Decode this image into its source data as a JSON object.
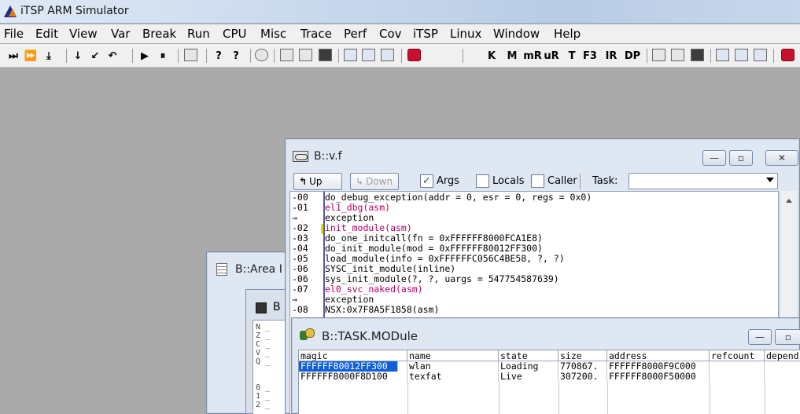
{
  "app": {
    "title": "iTSP ARM Simulator"
  },
  "menu": [
    "File",
    "Edit",
    "View",
    "Var",
    "Break",
    "Run",
    "CPU",
    "Misc",
    "Trace",
    "Perf",
    "Cov",
    "iTSP",
    "Linux",
    "Window",
    "Help"
  ],
  "toolbar": {
    "glyphs": [
      "⏭",
      "⏩",
      "⤓",
      "↓",
      "↙",
      "↶",
      "▶",
      "⏸"
    ],
    "letters": [
      "K",
      "M",
      "mR",
      "uR",
      "T",
      "F3",
      "IR",
      "DP"
    ],
    "help": [
      "?",
      "?"
    ]
  },
  "area_window": {
    "title": "B::Area I",
    "sub_title": "B",
    "regs": [
      "N _",
      "Z _",
      "C _",
      "V _",
      "Q _",
      "",
      "0 _",
      "1 _",
      "2 _"
    ]
  },
  "vf_window": {
    "title": "B::v.f",
    "up_label": "Up",
    "down_label": "Down",
    "args_label": "Args",
    "locals_label": "Locals",
    "caller_label": "Caller",
    "task_label": "Task:",
    "args_checked": "✓",
    "frames": [
      {
        "idx": "-00",
        "text": "do_debug_exception(addr = 0, esr = 0, regs = 0x0)",
        "hl": false
      },
      {
        "idx": "-01",
        "text": "el1_dbg(asm)",
        "hl": true
      },
      {
        "idx": "→",
        "text": "exception",
        "hl": false
      },
      {
        "idx": "-02",
        "text": "init_module(asm)",
        "hl": true
      },
      {
        "idx": "-03",
        "text": "do_one_initcall(fn = 0xFFFFFF8000FCA1E8)",
        "hl": false
      },
      {
        "idx": "-04",
        "text": "do_init_module(mod = 0xFFFFFF80012FF300)",
        "hl": false
      },
      {
        "idx": "-05",
        "text": "load_module(info = 0xFFFFFFC056C4BE58, ?, ?)",
        "hl": false
      },
      {
        "idx": "-06",
        "text": "SYSC_init_module(inline)",
        "hl": false
      },
      {
        "idx": "-06",
        "text": "sys_init_module(?, ?, uargs = 547754587639)",
        "hl": false
      },
      {
        "idx": "-07",
        "text": "el0_svc_naked(asm)",
        "hl": true
      },
      {
        "idx": "→",
        "text": "exception",
        "hl": false
      },
      {
        "idx": "-08",
        "text": "NSX:0x7F8A5F1858(asm)",
        "hl": false
      }
    ]
  },
  "task_window": {
    "title": "B::TASK.MODule",
    "columns": [
      "magic",
      "name",
      "state",
      "size",
      "address",
      "refcount",
      "depend"
    ],
    "rows": [
      [
        "FFFFFF80012FF300",
        "wlan",
        "Loading",
        "770867.",
        "FFFFFF8000F9C000",
        "",
        ""
      ],
      [
        "FFFFFF8000F8D100",
        "texfat",
        "Live",
        "307200.",
        "FFFFFF8000F50000",
        "",
        ""
      ]
    ]
  }
}
